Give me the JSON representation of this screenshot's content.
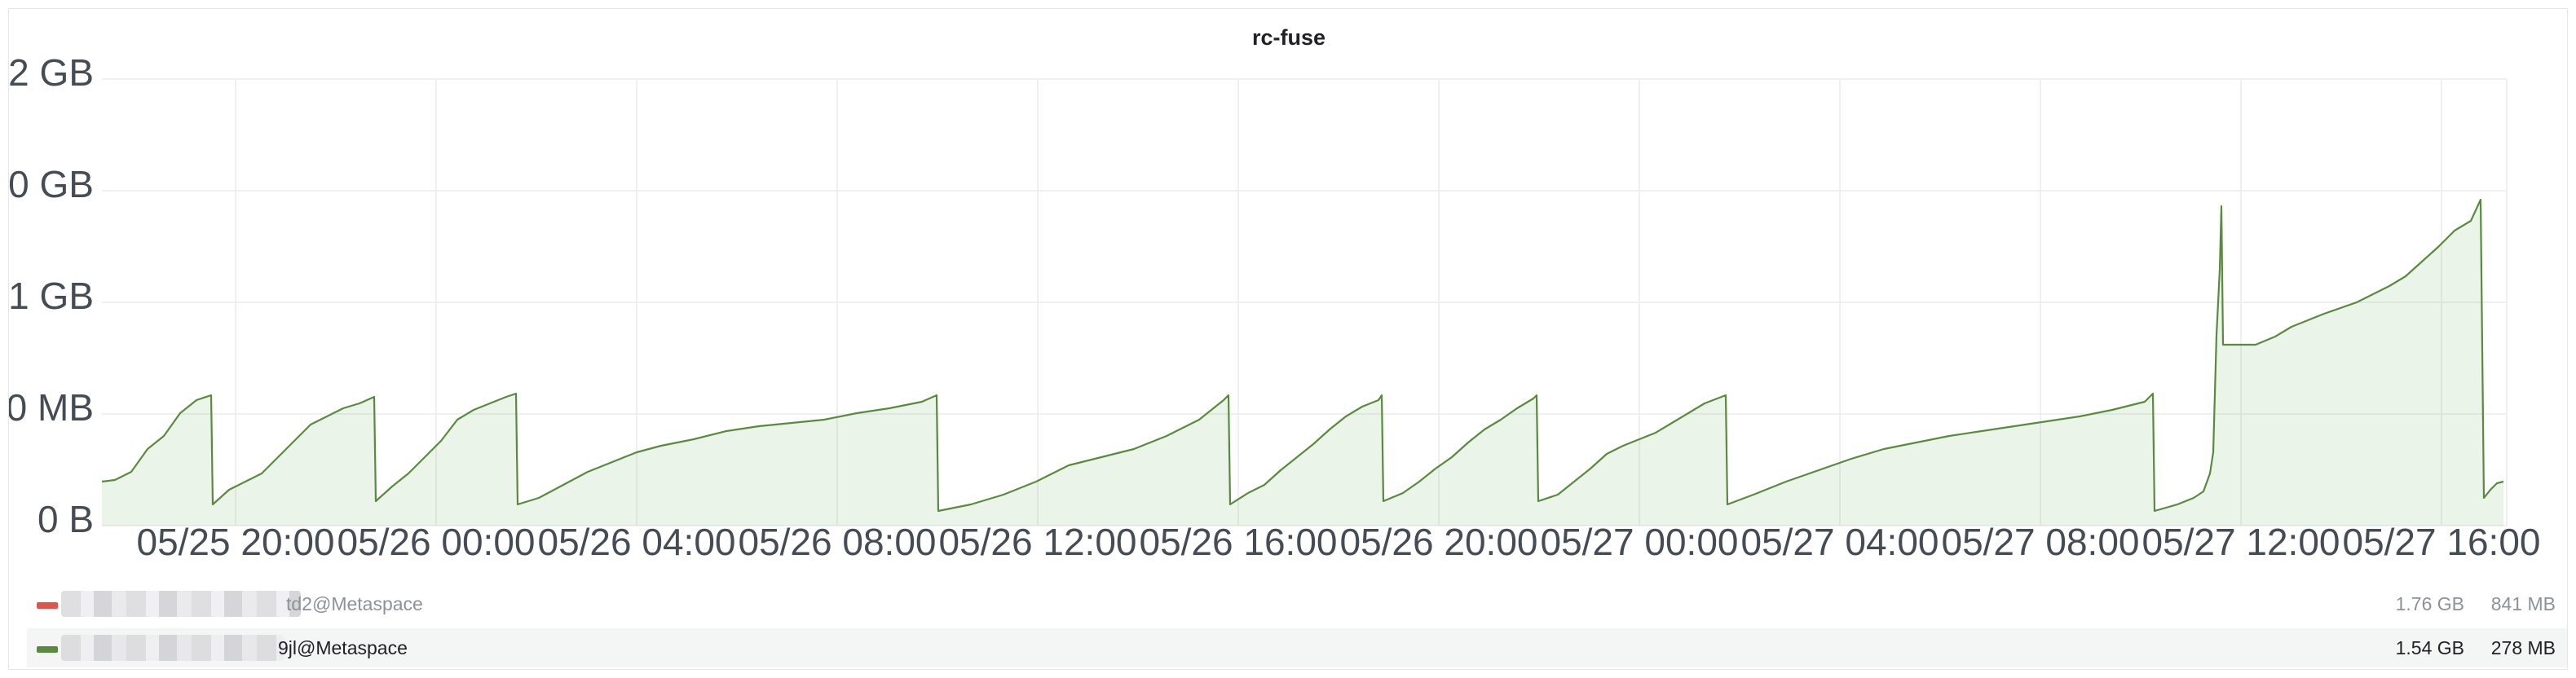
{
  "panel": {
    "title": "rc-fuse"
  },
  "chart_data": {
    "type": "area",
    "title": "rc-fuse",
    "y_ticks": [
      "0 B",
      "500 MB",
      "1 GB",
      "1.50 GB",
      "2 GB"
    ],
    "ylim": [
      0,
      2
    ],
    "y_unit": "GB",
    "x_ticks": [
      "05/25 20:00",
      "05/26 00:00",
      "05/26 04:00",
      "05/26 08:00",
      "05/26 12:00",
      "05/26 16:00",
      "05/26 20:00",
      "05/27 00:00",
      "05/27 04:00",
      "05/27 08:00",
      "05/27 12:00",
      "05/27 16:00"
    ],
    "x_unit": "hours since 05/25 17:20",
    "xlim": [
      0,
      47.7
    ],
    "grid": true,
    "series": [
      {
        "color": "#56a64b",
        "points": [
          [
            0,
            0.26
          ],
          [
            0.3,
            0.28
          ],
          [
            0.6,
            0.29
          ],
          [
            0.9,
            0.33
          ],
          [
            1.2,
            0.37
          ],
          [
            1.5,
            0.41
          ],
          [
            1.8,
            0.44
          ],
          [
            2.1,
            0.49
          ],
          [
            2.4,
            0.53
          ],
          [
            2.7,
            0.57
          ],
          [
            3.0,
            0.6
          ],
          [
            3.3,
            0.63
          ],
          [
            3.6,
            0.64
          ],
          [
            3.6,
            0.17
          ],
          [
            3.9,
            0.21
          ],
          [
            4.2,
            0.24
          ],
          [
            4.5,
            0.25
          ],
          [
            4.8,
            0.28
          ],
          [
            5.1,
            0.31
          ],
          [
            5.4,
            0.34
          ],
          [
            5.7,
            0.38
          ],
          [
            6.0,
            0.43
          ],
          [
            6.3,
            0.48
          ],
          [
            6.6,
            0.53
          ],
          [
            6.9,
            0.56
          ],
          [
            7.2,
            0.58
          ],
          [
            7.5,
            0.61
          ],
          [
            7.8,
            0.63
          ],
          [
            8.0,
            0.64
          ],
          [
            8.1,
            0.18
          ],
          [
            8.5,
            0.22
          ],
          [
            8.9,
            0.28
          ],
          [
            9.3,
            0.34
          ],
          [
            9.7,
            0.4
          ],
          [
            10.1,
            0.47
          ],
          [
            10.5,
            0.54
          ],
          [
            10.9,
            0.6
          ],
          [
            11.3,
            0.64
          ],
          [
            11.6,
            0.66
          ],
          [
            11.7,
            0.16
          ],
          [
            12.0,
            0.17
          ],
          [
            12.5,
            0.21
          ],
          [
            13.0,
            0.24
          ],
          [
            13.5,
            0.28
          ],
          [
            14.0,
            0.32
          ],
          [
            15.0,
            0.37
          ],
          [
            16.0,
            0.41
          ],
          [
            17.0,
            0.45
          ],
          [
            18.0,
            0.49
          ],
          [
            19.0,
            0.51
          ],
          [
            20.0,
            0.53
          ],
          [
            21.0,
            0.56
          ],
          [
            22.0,
            0.59
          ],
          [
            23.0,
            0.61
          ],
          [
            24.0,
            0.64
          ],
          [
            24.7,
            0.66
          ],
          [
            24.7,
            0.15
          ],
          [
            25.5,
            0.18
          ],
          [
            26.5,
            0.22
          ],
          [
            27.5,
            0.27
          ],
          [
            28.5,
            0.34
          ],
          [
            29.5,
            0.4
          ],
          [
            30.5,
            0.45
          ],
          [
            31.5,
            0.5
          ],
          [
            32.5,
            0.57
          ],
          [
            33.5,
            0.63
          ],
          [
            34.0,
            0.66
          ],
          [
            34.1,
            0.18
          ],
          [
            34.6,
            0.23
          ],
          [
            35.1,
            0.28
          ],
          [
            35.6,
            0.34
          ],
          [
            36.1,
            0.41
          ],
          [
            36.6,
            0.49
          ],
          [
            37.1,
            0.57
          ],
          [
            37.6,
            0.63
          ],
          [
            38.0,
            0.66
          ],
          [
            38.1,
            0.18
          ],
          [
            38.6,
            0.22
          ],
          [
            39.1,
            0.28
          ],
          [
            39.6,
            0.35
          ],
          [
            40.1,
            0.43
          ],
          [
            40.6,
            0.52
          ],
          [
            41.1,
            0.6
          ],
          [
            41.6,
            0.66
          ],
          [
            41.7,
            0.18
          ],
          [
            42.2,
            0.22
          ],
          [
            42.7,
            0.29
          ],
          [
            43.2,
            0.36
          ],
          [
            43.7,
            0.43
          ],
          [
            44.2,
            0.48
          ],
          [
            44.7,
            0.53
          ],
          [
            45.2,
            0.58
          ],
          [
            45.7,
            0.62
          ],
          [
            46.2,
            0.65
          ],
          [
            46.7,
            0.66
          ],
          [
            46.8,
            0.16
          ],
          [
            47.3,
            0.2
          ],
          [
            47.7,
            0.24
          ]
        ]
      }
    ],
    "series_draw": [
      [
        [
          57,
          290
        ],
        [
          65,
          289
        ],
        [
          75,
          284
        ],
        [
          85,
          270
        ],
        [
          95,
          262
        ],
        [
          105,
          248
        ],
        [
          115,
          240
        ],
        [
          124,
          237
        ]
      ],
      [
        [
          125,
          304
        ],
        [
          135,
          295
        ],
        [
          145,
          290
        ],
        [
          155,
          285
        ],
        [
          165,
          275
        ],
        [
          175,
          265
        ],
        [
          185,
          255
        ],
        [
          195,
          250
        ],
        [
          205,
          245
        ],
        [
          215,
          242
        ],
        [
          224,
          238
        ]
      ],
      [
        [
          225,
          302
        ],
        [
          235,
          293
        ],
        [
          245,
          285
        ],
        [
          255,
          275
        ],
        [
          265,
          265
        ],
        [
          275,
          252
        ],
        [
          285,
          246
        ],
        [
          295,
          242
        ],
        [
          305,
          238
        ],
        [
          311,
          236
        ]
      ],
      [
        [
          312,
          304
        ],
        [
          325,
          300
        ],
        [
          340,
          292
        ],
        [
          355,
          284
        ],
        [
          370,
          278
        ],
        [
          385,
          272
        ],
        [
          400,
          268
        ],
        [
          420,
          264
        ],
        [
          440,
          259
        ],
        [
          460,
          256
        ],
        [
          480,
          254
        ],
        [
          500,
          252
        ],
        [
          520,
          248
        ],
        [
          540,
          245
        ],
        [
          560,
          241
        ],
        [
          569,
          237
        ]
      ],
      [
        [
          570,
          308
        ],
        [
          590,
          304
        ],
        [
          610,
          298
        ],
        [
          630,
          290
        ],
        [
          650,
          280
        ],
        [
          670,
          275
        ],
        [
          690,
          270
        ],
        [
          710,
          262
        ],
        [
          730,
          252
        ],
        [
          745,
          240
        ],
        [
          748,
          237
        ]
      ],
      [
        [
          749,
          304
        ],
        [
          760,
          297
        ],
        [
          770,
          292
        ],
        [
          780,
          283
        ],
        [
          790,
          275
        ],
        [
          800,
          267
        ],
        [
          810,
          258
        ],
        [
          820,
          250
        ],
        [
          830,
          244
        ],
        [
          840,
          240
        ],
        [
          842,
          237
        ]
      ],
      [
        [
          843,
          302
        ],
        [
          855,
          297
        ],
        [
          865,
          290
        ],
        [
          875,
          282
        ],
        [
          885,
          275
        ],
        [
          895,
          266
        ],
        [
          905,
          258
        ],
        [
          915,
          252
        ],
        [
          925,
          245
        ],
        [
          935,
          239
        ],
        [
          937,
          237
        ]
      ],
      [
        [
          938,
          302
        ],
        [
          950,
          298
        ],
        [
          960,
          290
        ],
        [
          970,
          282
        ],
        [
          980,
          273
        ],
        [
          990,
          268
        ],
        [
          1000,
          264
        ],
        [
          1010,
          260
        ],
        [
          1020,
          254
        ],
        [
          1030,
          248
        ],
        [
          1040,
          242
        ],
        [
          1053,
          237
        ]
      ],
      [
        [
          1054,
          304
        ],
        [
          1070,
          298
        ],
        [
          1090,
          290
        ],
        [
          1110,
          283
        ],
        [
          1130,
          276
        ],
        [
          1150,
          270
        ],
        [
          1170,
          266
        ],
        [
          1190,
          262
        ],
        [
          1210,
          259
        ],
        [
          1230,
          256
        ],
        [
          1250,
          253
        ],
        [
          1270,
          250
        ],
        [
          1290,
          246
        ],
        [
          1310,
          241
        ],
        [
          1315,
          236
        ]
      ],
      [
        [
          1316,
          308
        ],
        [
          1330,
          304
        ],
        [
          1340,
          300
        ],
        [
          1346,
          296
        ],
        [
          1350,
          285
        ],
        [
          1352,
          272
        ],
        [
          1354,
          200
        ],
        [
          1356,
          160
        ],
        [
          1357,
          121
        ],
        [
          1358,
          206
        ],
        [
          1378,
          206
        ],
        [
          1390,
          201
        ],
        [
          1400,
          195
        ],
        [
          1420,
          187
        ],
        [
          1440,
          180
        ],
        [
          1460,
          170
        ],
        [
          1470,
          164
        ],
        [
          1480,
          155
        ],
        [
          1490,
          146
        ],
        [
          1500,
          136
        ],
        [
          1510,
          130
        ],
        [
          1516,
          117
        ]
      ],
      [
        [
          1518,
          300
        ],
        [
          1522,
          295
        ],
        [
          1526,
          291
        ],
        [
          1530,
          290
        ]
      ]
    ]
  },
  "legend": [
    {
      "name": "td2@Metaspace",
      "color": "#e0544a",
      "max": "1.76 GB",
      "current": "841 MB"
    },
    {
      "name": "9jl@Metaspace",
      "color": "#5a8a3f",
      "max": "1.54 GB",
      "current": "278 MB"
    }
  ]
}
